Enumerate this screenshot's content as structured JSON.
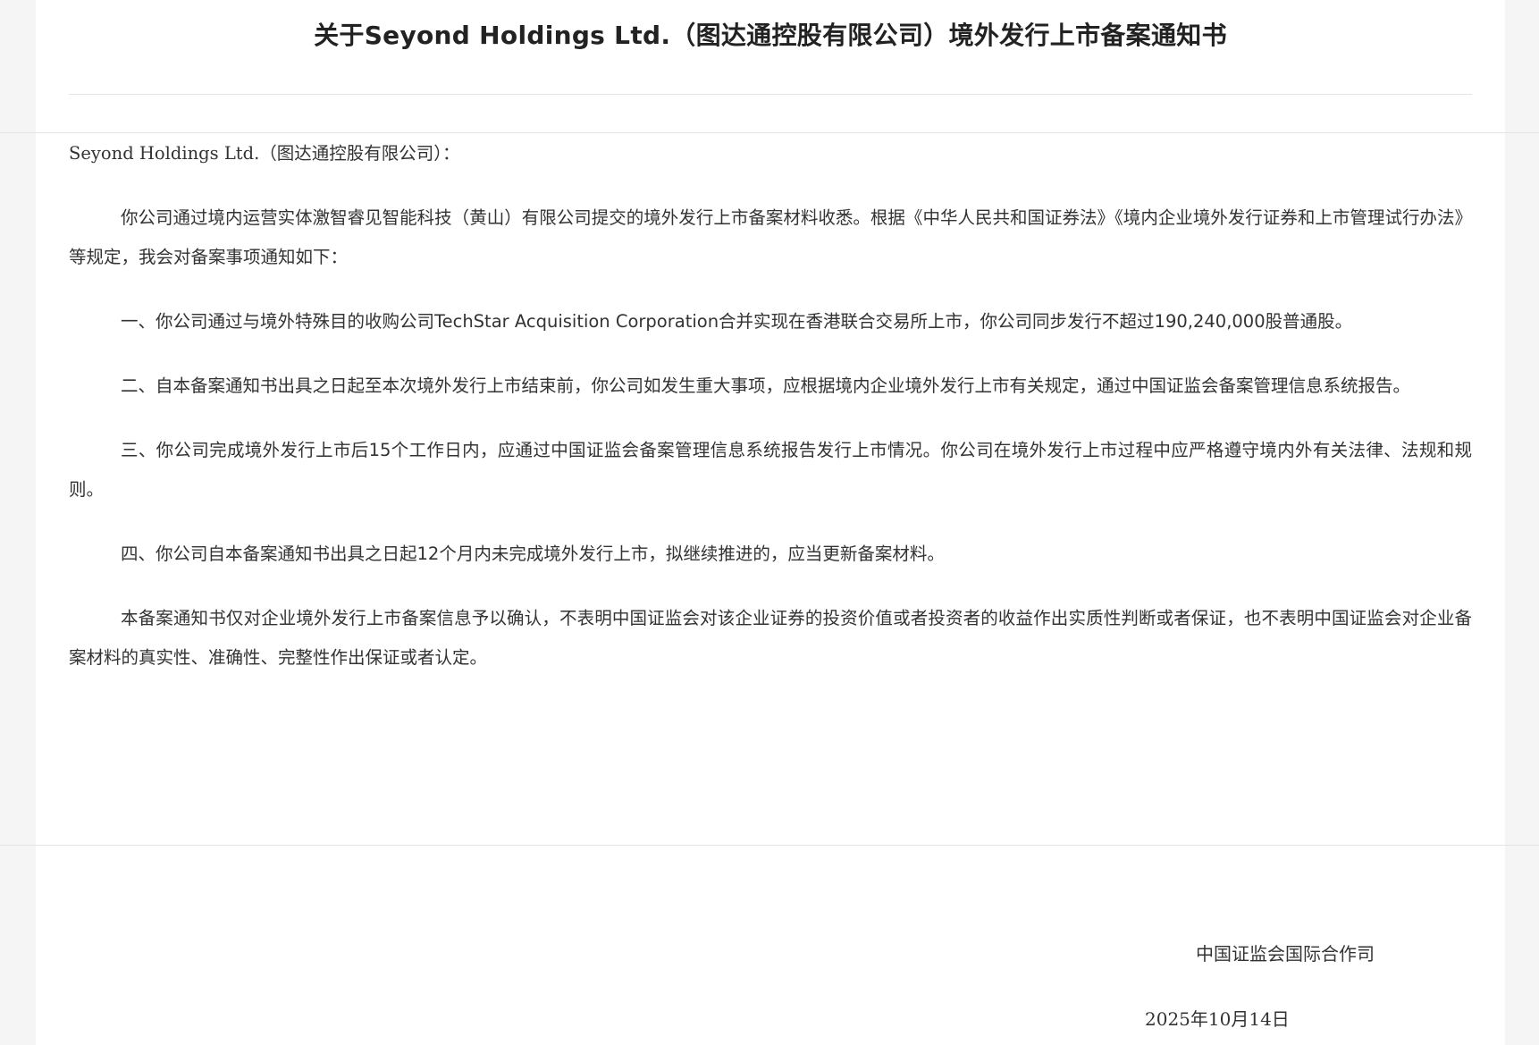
{
  "document": {
    "title": "关于Seyond Holdings Ltd.（图达通控股有限公司）境外发行上市备案通知书",
    "salutation": "Seyond Holdings Ltd.（图达通控股有限公司）：",
    "paragraphs": [
      "你公司通过境内运营实体激智睿见智能科技（黄山）有限公司提交的境外发行上市备案材料收悉。根据《中华人民共和国证券法》《境内企业境外发行证券和上市管理试行办法》等规定，我会对备案事项通知如下：",
      "一、你公司通过与境外特殊目的收购公司TechStar Acquisition Corporation合并实现在香港联合交易所上市，你公司同步发行不超过190,240,000股普通股。",
      "二、自本备案通知书出具之日起至本次境外发行上市结束前，你公司如发生重大事项，应根据境内企业境外发行上市有关规定，通过中国证监会备案管理信息系统报告。",
      "三、你公司完成境外发行上市后15个工作日内，应通过中国证监会备案管理信息系统报告发行上市情况。你公司在境外发行上市过程中应严格遵守境内外有关法律、法规和规则。",
      "四、你公司自本备案通知书出具之日起12个月内未完成境外发行上市，拟继续推进的，应当更新备案材料。",
      "本备案通知书仅对企业境外发行上市备案信息予以确认，不表明中国证监会对该企业证券的投资价值或者投资者的收益作出实质性判断或者保证，也不表明中国证监会对企业备案材料的真实性、准确性、完整性作出保证或者认定。"
    ],
    "issuer": "中国证监会国际合作司",
    "date": "2025年10月14日"
  }
}
